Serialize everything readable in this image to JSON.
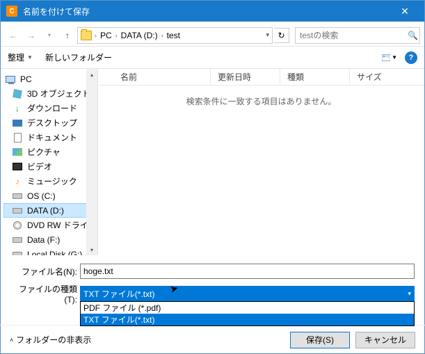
{
  "titlebar": {
    "title": "名前を付けて保存"
  },
  "breadcrumbs": [
    "PC",
    "DATA (D:)",
    "test"
  ],
  "search": {
    "placeholder": "testの検索"
  },
  "toolbar": {
    "organize": "整理",
    "newfolder": "新しいフォルダー"
  },
  "tree": {
    "root": "PC",
    "items": [
      {
        "label": "3D オブジェクト",
        "icon": "cube"
      },
      {
        "label": "ダウンロード",
        "icon": "download"
      },
      {
        "label": "デスクトップ",
        "icon": "desktop"
      },
      {
        "label": "ドキュメント",
        "icon": "document"
      },
      {
        "label": "ピクチャ",
        "icon": "picture"
      },
      {
        "label": "ビデオ",
        "icon": "video"
      },
      {
        "label": "ミュージック",
        "icon": "music"
      },
      {
        "label": "OS (C:)",
        "icon": "drive"
      },
      {
        "label": "DATA (D:)",
        "icon": "drive",
        "selected": true
      },
      {
        "label": "DVD RW ドライブ (",
        "icon": "dvd"
      },
      {
        "label": "Data (F:)",
        "icon": "drive"
      },
      {
        "label": "Local Disk (G:)",
        "icon": "drive"
      }
    ]
  },
  "list": {
    "columns": [
      "名前",
      "更新日時",
      "種類",
      "サイズ"
    ],
    "empty_msg": "検索条件に一致する項目はありません。"
  },
  "form": {
    "filename_label": "ファイル名(N):",
    "filename_value": "hoge.txt",
    "filetype_label": "ファイルの種類(T):",
    "filetype_selected": "TXT ファイル(*.txt)",
    "filetype_options": [
      "PDF ファイル (*.pdf)",
      "TXT ファイル(*.txt)"
    ]
  },
  "bottom": {
    "hide_folders": "フォルダーの非表示",
    "save": "保存(S)",
    "cancel": "キャンセル"
  }
}
